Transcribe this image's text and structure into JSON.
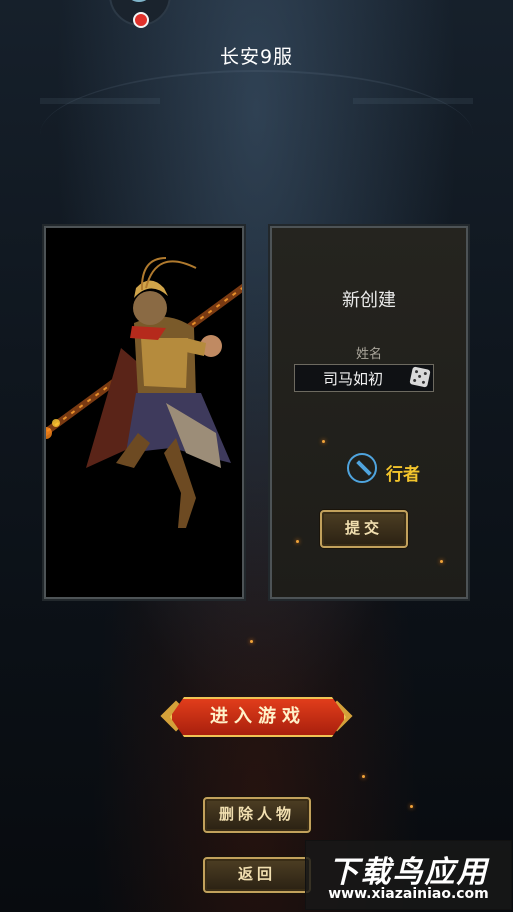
{
  "server": {
    "title": "长安9服"
  },
  "create_panel": {
    "title": "新创建",
    "name_label": "姓名",
    "name_value": "司马如初",
    "class_name": "行者",
    "submit_label": "提交"
  },
  "actions": {
    "enter_game": "进入游戏",
    "delete_character": "删除人物",
    "back": "返回"
  },
  "watermark": {
    "title": "下载鸟应用",
    "url": "www.xiazainiao.com"
  },
  "colors": {
    "accent_gold": "#c2a15c",
    "class_color": "#f2c42c",
    "enter_red": "#e13d1b",
    "notice_dot": "#e0312b"
  }
}
